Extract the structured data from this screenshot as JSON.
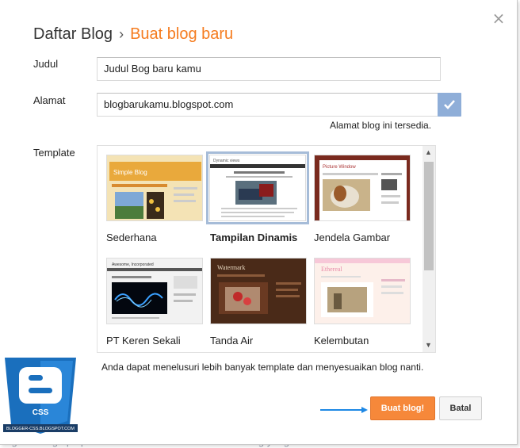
{
  "background": {
    "text": "engikuti blog apa pun. Klik di sini untuk memasukkan blog yang akan diikuti dalam Daftar Bacaan"
  },
  "dialog": {
    "close_label": "×",
    "breadcrumb": {
      "parent": "Daftar Blog",
      "separator": "›",
      "current": "Buat blog baru"
    },
    "fields": {
      "title_label": "Judul",
      "title_value": "Judul Bog baru kamu",
      "address_label": "Alamat",
      "address_value": "blogbarukamu.blogspot.com",
      "address_hint": "Alamat blog ini tersedia."
    },
    "template": {
      "label": "Template",
      "items": [
        {
          "name": "Sederhana",
          "thumb_title": "Simple Blog"
        },
        {
          "name": "Tampilan Dinamis",
          "thumb_title": "Dynamic views",
          "selected": true
        },
        {
          "name": "Jendela Gambar",
          "thumb_title": "Picture Window"
        },
        {
          "name": "PT Keren Sekali",
          "thumb_title": "Awesome, Incorporated"
        },
        {
          "name": "Tanda Air",
          "thumb_title": "Watermark"
        },
        {
          "name": "Kelembutan",
          "thumb_title": "Ethereal"
        }
      ],
      "more_text": "Anda dapat menelusuri lebih banyak template dan menyesuaikan blog nanti."
    },
    "buttons": {
      "create": "Buat blog!",
      "cancel": "Batal"
    }
  },
  "watermark": {
    "badge": "CSS",
    "caption": "BLOGGER-CSS.BLOGSPOT.COM"
  },
  "colors": {
    "accent": "#f57c1f",
    "create_button": "#f6883a",
    "check_button": "#8faed8",
    "arrow": "#1e88e5",
    "logo": "#1a6fbd"
  }
}
